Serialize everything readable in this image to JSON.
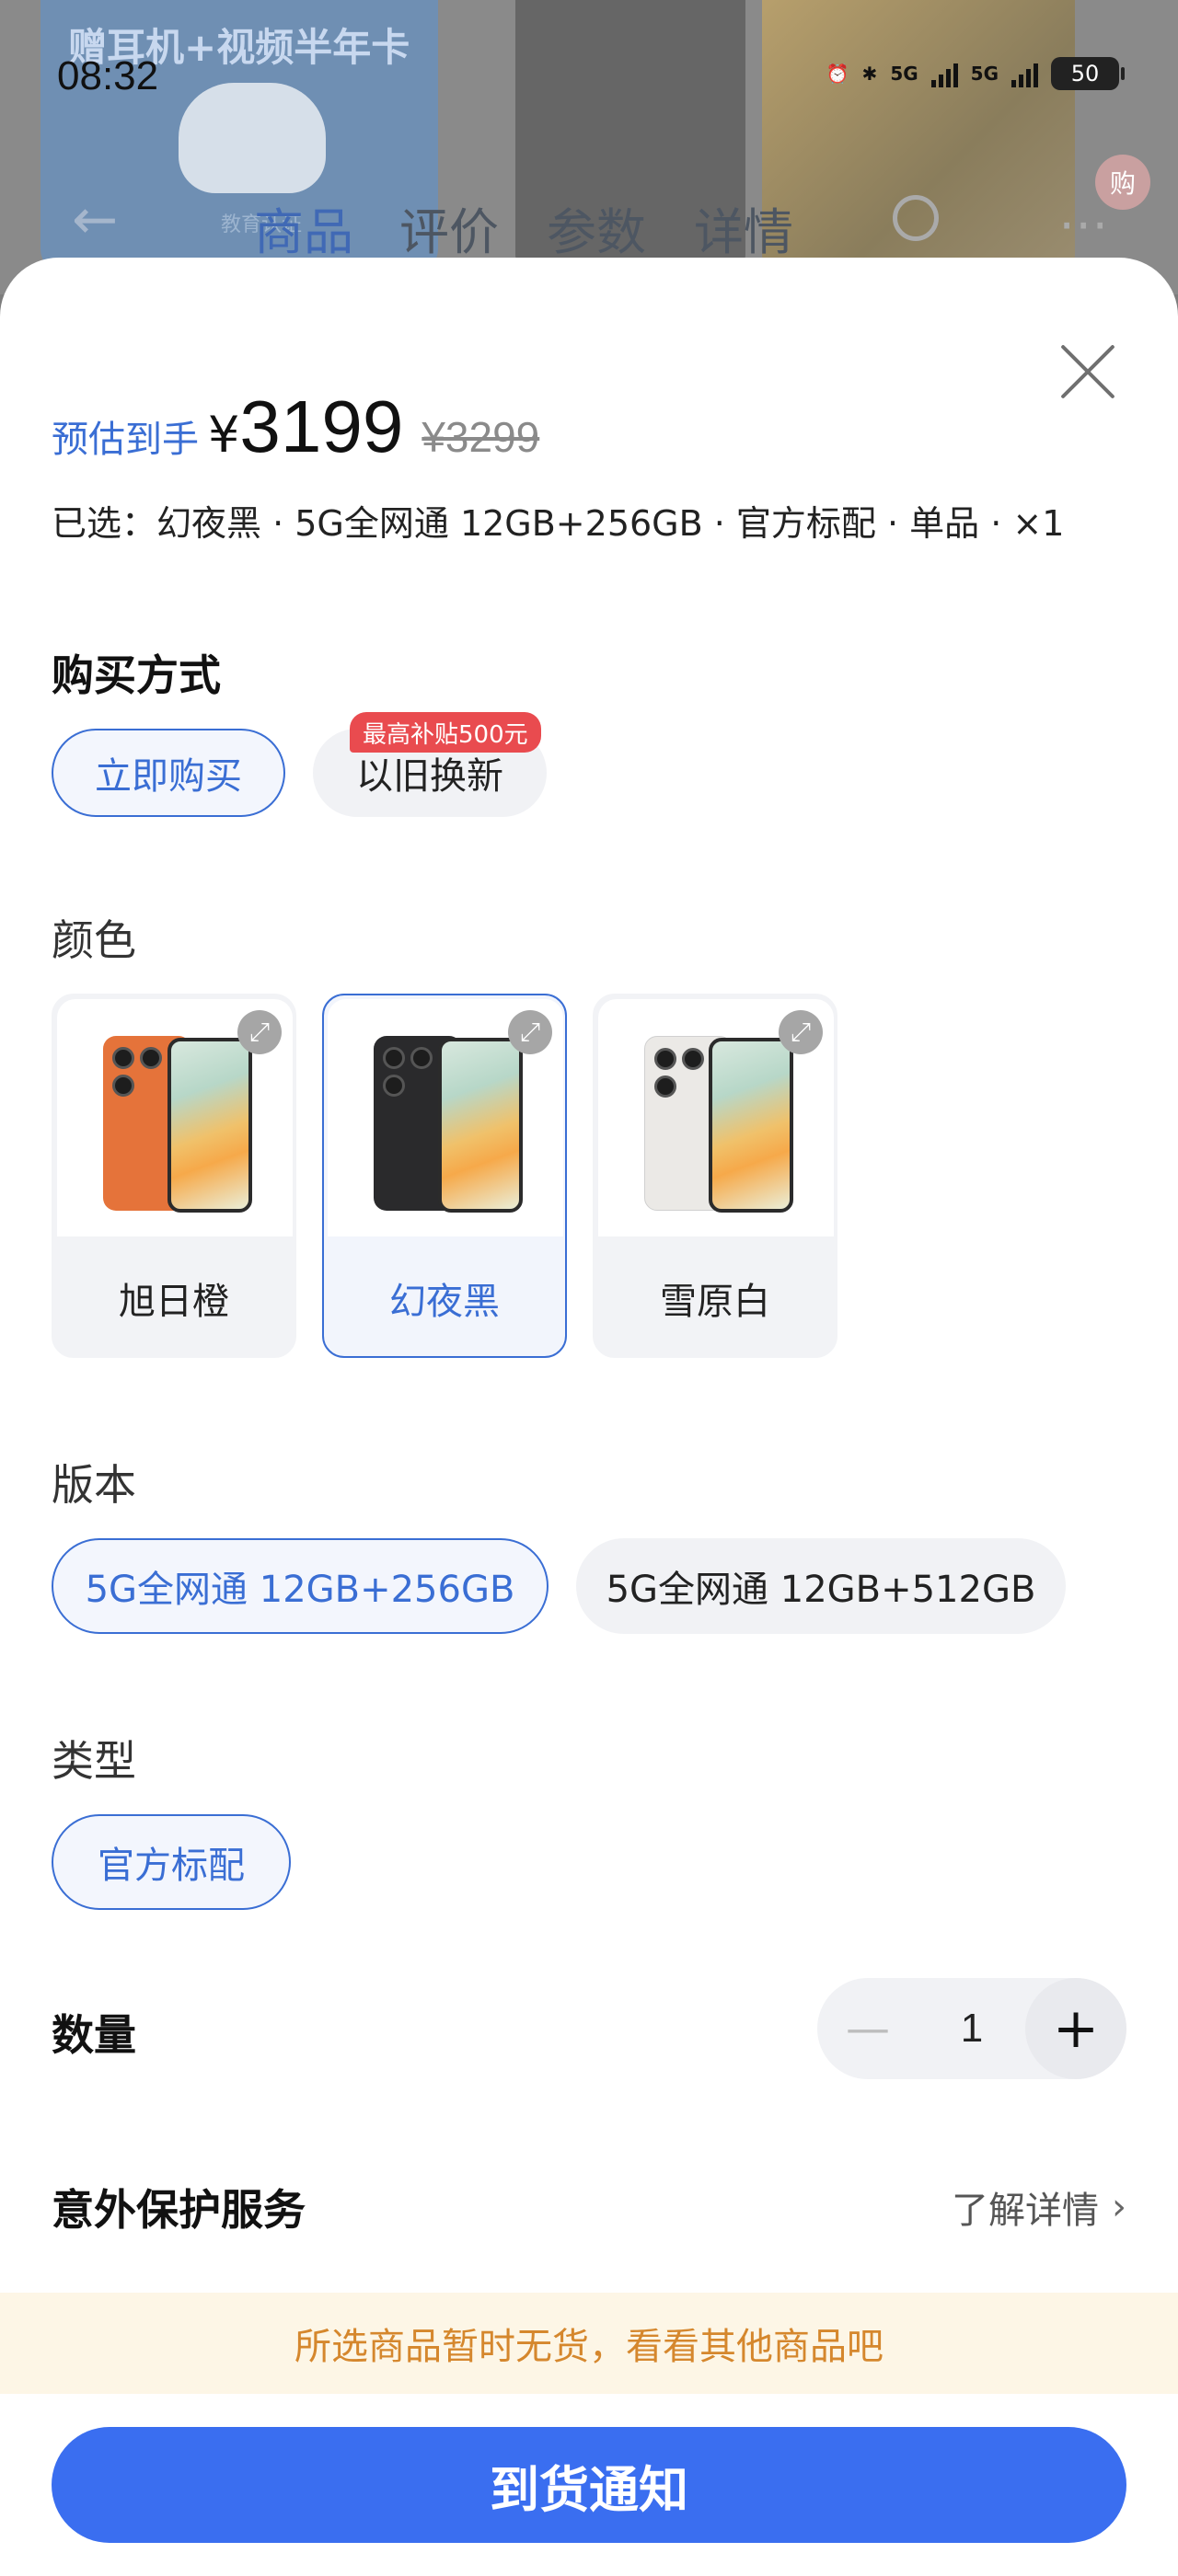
{
  "status_bar": {
    "time": "08:32",
    "signal1": "5G",
    "signal2": "5G",
    "battery": "50"
  },
  "background_page": {
    "promo_text": "赠耳机+视频半年卡",
    "edu_text": "教育认证",
    "tabs": [
      "商品",
      "评价",
      "参数",
      "详情"
    ],
    "active_tab": "商品",
    "badge": "购"
  },
  "sheet": {
    "price": {
      "label": "预估到手",
      "currency": "¥",
      "value": "3199",
      "original": "¥3299"
    },
    "selected_summary": "已选：幻夜黑 · 5G全网通 12GB+256GB · 官方标配 · 单品 · ×1",
    "purchase_method": {
      "title": "购买方式",
      "options": [
        {
          "label": "立即购买",
          "selected": true
        },
        {
          "label": "以旧换新",
          "selected": false,
          "badge": "最高补贴500元"
        }
      ]
    },
    "color": {
      "title": "颜色",
      "options": [
        {
          "label": "旭日橙",
          "selected": false,
          "phone_color": "#e5733a"
        },
        {
          "label": "幻夜黑",
          "selected": true,
          "phone_color": "#2a2a2c"
        },
        {
          "label": "雪原白",
          "selected": false,
          "phone_color": "#ebe9e6"
        }
      ]
    },
    "version": {
      "title": "版本",
      "options": [
        {
          "label": "5G全网通 12GB+256GB",
          "selected": true
        },
        {
          "label": "5G全网通 12GB+512GB",
          "selected": false
        }
      ]
    },
    "type": {
      "title": "类型",
      "options": [
        {
          "label": "官方标配",
          "selected": true
        }
      ]
    },
    "quantity": {
      "title": "数量",
      "value": "1",
      "minus": "—",
      "plus": "+"
    },
    "protection": {
      "title": "意外保护服务",
      "link": "了解详情"
    },
    "notice": "所选商品暂时无货，看看其他商品吧",
    "notify_button": "到货通知"
  },
  "colors": {
    "accent": "#3a6ed4",
    "button": "#3a6ef0",
    "notice_text": "#d5872d",
    "notice_bg": "#fdf6e6",
    "badge_red": "#e94b4f"
  }
}
